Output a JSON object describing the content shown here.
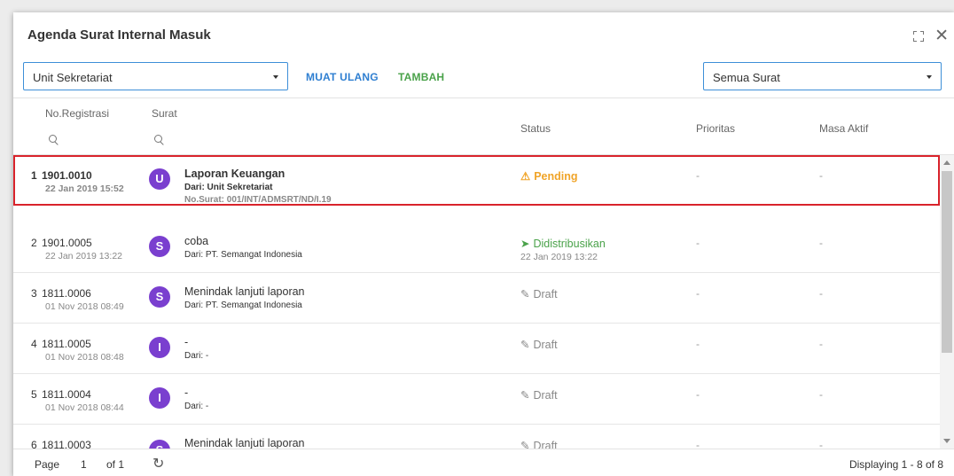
{
  "window": {
    "title": "Agenda Surat Internal Masuk"
  },
  "toolbar": {
    "unit_select": "Unit Sekretariat",
    "reload_label": "MUAT ULANG",
    "add_label": "TAMBAH",
    "filter_select": "Semua Surat"
  },
  "columns": {
    "no_registrasi": "No.Registrasi",
    "surat": "Surat",
    "status": "Status",
    "prioritas": "Prioritas",
    "masa_aktif": "Masa Aktif"
  },
  "rows": [
    {
      "num": "1",
      "reg": "1901.0010",
      "date": "22 Jan 2019 15:52",
      "avatar": "U",
      "subject": "Laporan Keuangan",
      "from": "Dari: Unit Sekretariat",
      "no_surat": "No.Surat: 001/INT/ADMSRT/ND/I.19",
      "status": "Pending",
      "status_date": "",
      "prioritas": "-",
      "masa_aktif": "-"
    },
    {
      "num": "2",
      "reg": "1901.0005",
      "date": "22 Jan 2019 13:22",
      "avatar": "S",
      "subject": "coba",
      "from": "Dari: PT. Semangat Indonesia",
      "no_surat": "",
      "status": "Didistribusikan",
      "status_date": "22 Jan 2019 13:22",
      "prioritas": "-",
      "masa_aktif": "-"
    },
    {
      "num": "3",
      "reg": "1811.0006",
      "date": "01 Nov 2018 08:49",
      "avatar": "S",
      "subject": "Menindak lanjuti laporan",
      "from": "Dari: PT. Semangat Indonesia",
      "no_surat": "",
      "status": "Draft",
      "status_date": "",
      "prioritas": "-",
      "masa_aktif": "-"
    },
    {
      "num": "4",
      "reg": "1811.0005",
      "date": "01 Nov 2018 08:48",
      "avatar": "I",
      "subject": "-",
      "from": "Dari: -",
      "no_surat": "",
      "status": "Draft",
      "status_date": "",
      "prioritas": "-",
      "masa_aktif": "-"
    },
    {
      "num": "5",
      "reg": "1811.0004",
      "date": "01 Nov 2018 08:44",
      "avatar": "I",
      "subject": "-",
      "from": "Dari: -",
      "no_surat": "",
      "status": "Draft",
      "status_date": "",
      "prioritas": "-",
      "masa_aktif": "-"
    },
    {
      "num": "6",
      "reg": "1811.0003",
      "date": "",
      "avatar": "S",
      "subject": "Menindak lanjuti laporan",
      "from": "",
      "no_surat": "",
      "status": "Draft",
      "status_date": "",
      "prioritas": "-",
      "masa_aktif": "-"
    }
  ],
  "footer": {
    "page_label": "Page",
    "page_number": "1",
    "of_label": "of 1",
    "displaying": "Displaying 1 - 8 of 8"
  },
  "colors": {
    "accent_blue": "#2f7fd1",
    "add_green": "#4aa24a",
    "avatar_purple": "#7a3fcf",
    "pending_orange": "#f0a428",
    "selection_red": "#d9232b"
  },
  "icons": {
    "expand": "expand-icon",
    "close": "close-icon",
    "search": "search-icon",
    "pending": "warning-icon",
    "distributed": "send-arrow-icon",
    "draft": "pencil-icon",
    "refresh": "refresh-icon"
  }
}
